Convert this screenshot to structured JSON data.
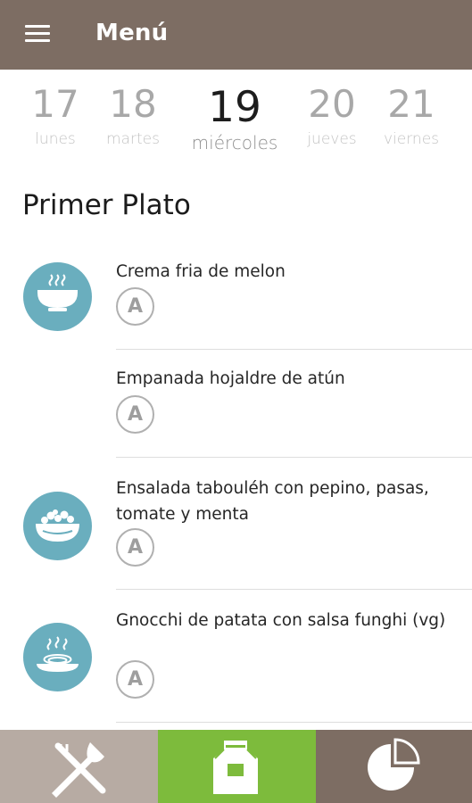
{
  "header": {
    "title": "Menú",
    "menu_icon": "hamburger-menu-icon"
  },
  "days": [
    {
      "num": "17",
      "name": "lunes",
      "selected": false
    },
    {
      "num": "18",
      "name": "martes",
      "selected": false
    },
    {
      "num": "19",
      "name": "miércoles",
      "selected": true
    },
    {
      "num": "20",
      "name": "jueves",
      "selected": false
    },
    {
      "num": "21",
      "name": "viernes",
      "selected": false
    }
  ],
  "section": {
    "title": "Primer Plato"
  },
  "items": [
    {
      "name": "Crema fria de melon",
      "icon": "soup-bowl-icon",
      "allergen": "A"
    },
    {
      "name": "Empanada hojaldre de atún",
      "icon": "",
      "allergen": "A"
    },
    {
      "name": "Ensalada tabouléh con pepino, pasas, tomate y menta",
      "icon": "salad-bowl-icon",
      "allergen": "A"
    },
    {
      "name": "Gnocchi de patata con salsa funghi (vg)",
      "icon": "pasta-plate-icon",
      "allergen": "A"
    }
  ],
  "bottom_nav": [
    {
      "name": "menu",
      "icon": "fork-knife-icon"
    },
    {
      "name": "shopping",
      "icon": "shopping-bag-icon"
    },
    {
      "name": "stats",
      "icon": "pie-chart-icon"
    }
  ],
  "colors": {
    "appbar": "#7d6d63",
    "accent_blue": "#6aaebe",
    "nav_menu": "#b7aba3",
    "nav_bag": "#7dbb3c",
    "nav_stats": "#7d6d63"
  }
}
